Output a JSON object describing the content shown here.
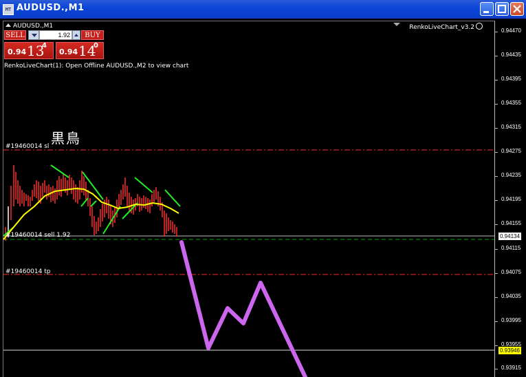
{
  "window": {
    "title": "AUDUSD.,M1"
  },
  "chart": {
    "symbol_label": "AUDUSD.,M1",
    "indicator_label": "RenkoLiveChart_v3.2",
    "info_line": "RenkoLiveChart(1): Open Offline AUDUSD.,M2 to view chart",
    "watermark_text": "黒鳥"
  },
  "trade_panel": {
    "sell_label": "SELL",
    "buy_label": "BUY",
    "lot_value": "1.92",
    "sell_quote": {
      "prefix": "0.94",
      "big": "13",
      "sup": "4"
    },
    "buy_quote": {
      "prefix": "0.94",
      "big": "14",
      "sup": "0"
    }
  },
  "order_lines": {
    "sl_label": "#19460014 sl",
    "sell_label": "#19460014 sell 1.92",
    "tp_label": "#19460014 tp"
  },
  "price_axis": {
    "ticks": [
      "0.94470",
      "0.94435",
      "0.94395",
      "0.94355",
      "0.94315",
      "0.94275",
      "0.94235",
      "0.94195",
      "0.94155",
      "0.94115",
      "0.94075",
      "0.94035",
      "0.93995",
      "0.93955",
      "0.93915"
    ],
    "bid_price": "0.94134",
    "mark_price": "0.93946"
  },
  "colors": {
    "background": "#000000",
    "sl_tp_line": "#ff2a2a",
    "open_line": "#00aa00",
    "candle": "#ff2a2a",
    "ma": "#ffff00",
    "renko": "#22ee22",
    "annotation": "#cc66ee"
  }
}
